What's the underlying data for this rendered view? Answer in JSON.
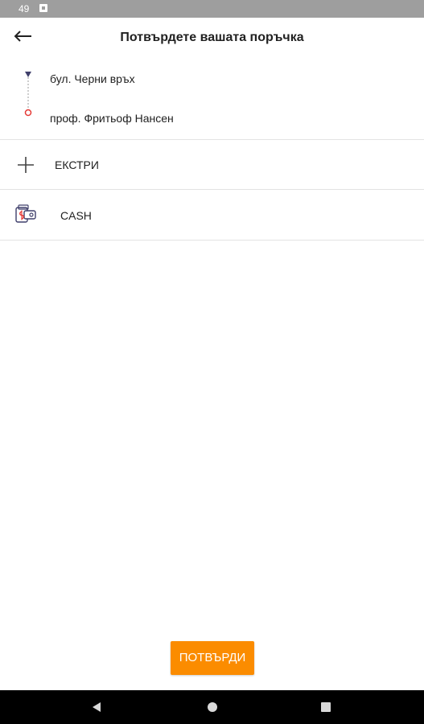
{
  "status_bar": {
    "time": "49",
    "notification_icon": "notification-icon"
  },
  "app_bar": {
    "back_icon": "back-arrow-icon",
    "title": "Потвърдете вашата поръчка"
  },
  "route": {
    "pickup": "бул. Черни връх",
    "destination": "проф. Фритьоф Нансен",
    "pickup_marker_color": "#3f3f6b",
    "destination_marker_color": "#e53935"
  },
  "extras": {
    "icon": "plus-icon",
    "label": "ЕКСТРИ"
  },
  "payment": {
    "icon": "cash-icon",
    "label": "CASH"
  },
  "confirm": {
    "label": "ПОТВЪРДИ",
    "color": "#fb8c00"
  },
  "nav_bar": {
    "back_icon": "nav-back-icon",
    "home_icon": "nav-home-icon",
    "recents_icon": "nav-recents-icon"
  }
}
